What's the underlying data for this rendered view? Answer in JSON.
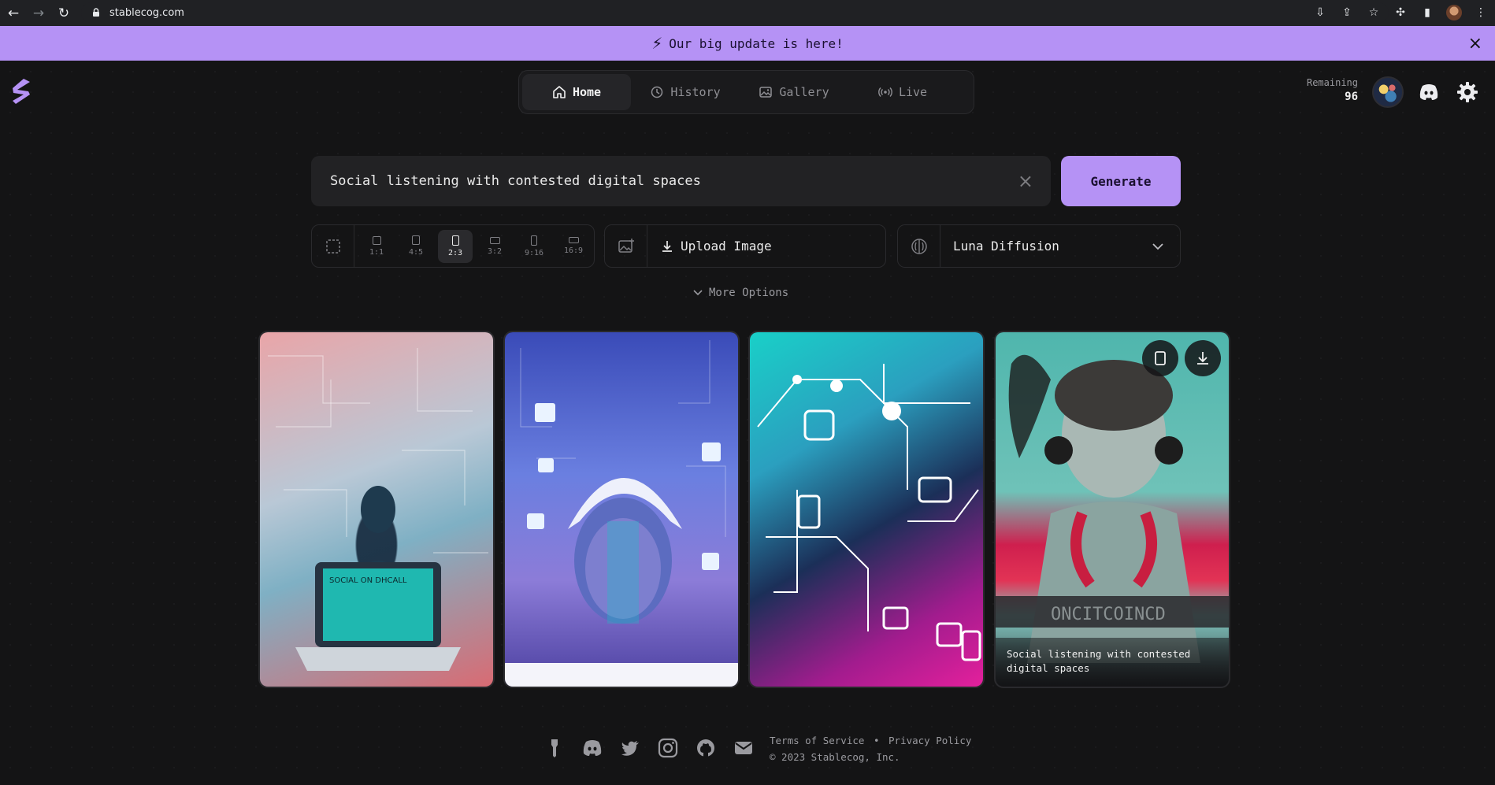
{
  "browser": {
    "url": "stablecog.com",
    "nav": {
      "back": "←",
      "forward": "→",
      "reload": "↻"
    }
  },
  "banner": {
    "text": "Our big update is here!",
    "close_icon": "×",
    "bolt_icon": "⚡"
  },
  "nav": {
    "tabs": [
      {
        "label": "Home",
        "icon": "home-icon",
        "active": true
      },
      {
        "label": "History",
        "icon": "history-icon",
        "active": false
      },
      {
        "label": "Gallery",
        "icon": "gallery-icon",
        "active": false
      },
      {
        "label": "Live",
        "icon": "live-icon",
        "active": false
      }
    ]
  },
  "account": {
    "remaining_label": "Remaining",
    "remaining_count": "96"
  },
  "prompt": {
    "value": "Social listening with contested digital spaces",
    "clear_icon": "×"
  },
  "generate_label": "Generate",
  "aspect_ratios": [
    {
      "label": "1:1",
      "active": false
    },
    {
      "label": "4:5",
      "active": false
    },
    {
      "label": "2:3",
      "active": true
    },
    {
      "label": "3:2",
      "active": false
    },
    {
      "label": "9:16",
      "active": false
    },
    {
      "label": "16:9",
      "active": false
    }
  ],
  "upload_label": "Upload Image",
  "model": {
    "name": "Luna Diffusion"
  },
  "more_options_label": "More Options",
  "results": {
    "caption": "Social listening with contested digital spaces"
  },
  "footer": {
    "terms": "Terms of Service",
    "separator": "•",
    "privacy": "Privacy Policy",
    "copyright": "© 2023 Stablecog, Inc."
  },
  "colors": {
    "accent": "#b592f5",
    "background": "#141415"
  }
}
